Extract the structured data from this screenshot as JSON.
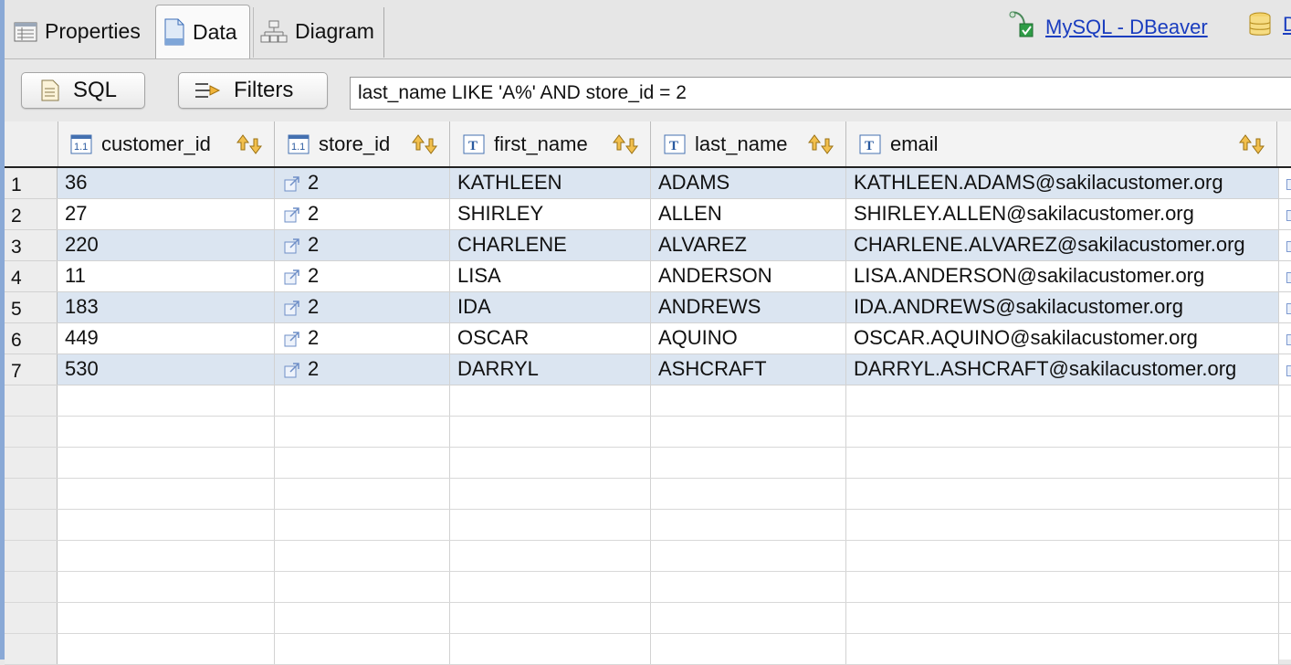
{
  "tabs": {
    "properties": "Properties",
    "data": "Data",
    "diagram": "Diagram"
  },
  "connection": {
    "link": "MySQL - DBeaver",
    "second_link": "D"
  },
  "toolbar": {
    "sql_label": "SQL",
    "filters_label": "Filters",
    "filter_value": "last_name LIKE 'A%' AND store_id = 2"
  },
  "columns": [
    {
      "name": "customer_id",
      "type_icon": "numeric-key-icon"
    },
    {
      "name": "store_id",
      "type_icon": "numeric-key-icon"
    },
    {
      "name": "first_name",
      "type_icon": "text-type-icon"
    },
    {
      "name": "last_name",
      "type_icon": "text-type-icon"
    },
    {
      "name": "email",
      "type_icon": "text-type-icon"
    }
  ],
  "rows": [
    {
      "n": "1",
      "customer_id": "36",
      "store_id": "2",
      "first_name": "KATHLEEN",
      "last_name": "ADAMS",
      "email": "KATHLEEN.ADAMS@sakilacustomer.org"
    },
    {
      "n": "2",
      "customer_id": "27",
      "store_id": "2",
      "first_name": "SHIRLEY",
      "last_name": "ALLEN",
      "email": "SHIRLEY.ALLEN@sakilacustomer.org"
    },
    {
      "n": "3",
      "customer_id": "220",
      "store_id": "2",
      "first_name": "CHARLENE",
      "last_name": "ALVAREZ",
      "email": "CHARLENE.ALVAREZ@sakilacustomer.org"
    },
    {
      "n": "4",
      "customer_id": "11",
      "store_id": "2",
      "first_name": "LISA",
      "last_name": "ANDERSON",
      "email": "LISA.ANDERSON@sakilacustomer.org"
    },
    {
      "n": "5",
      "customer_id": "183",
      "store_id": "2",
      "first_name": "IDA",
      "last_name": "ANDREWS",
      "email": "IDA.ANDREWS@sakilacustomer.org"
    },
    {
      "n": "6",
      "customer_id": "449",
      "store_id": "2",
      "first_name": "OSCAR",
      "last_name": "AQUINO",
      "email": "OSCAR.AQUINO@sakilacustomer.org"
    },
    {
      "n": "7",
      "customer_id": "530",
      "store_id": "2",
      "first_name": "DARRYL",
      "last_name": "ASHCRAFT",
      "email": "DARRYL.ASHCRAFT@sakilacustomer.org"
    }
  ],
  "colors": {
    "row_stripe": "#dbe5f1",
    "link": "#1a3dbf",
    "left_accent": "#8aa9d6"
  }
}
